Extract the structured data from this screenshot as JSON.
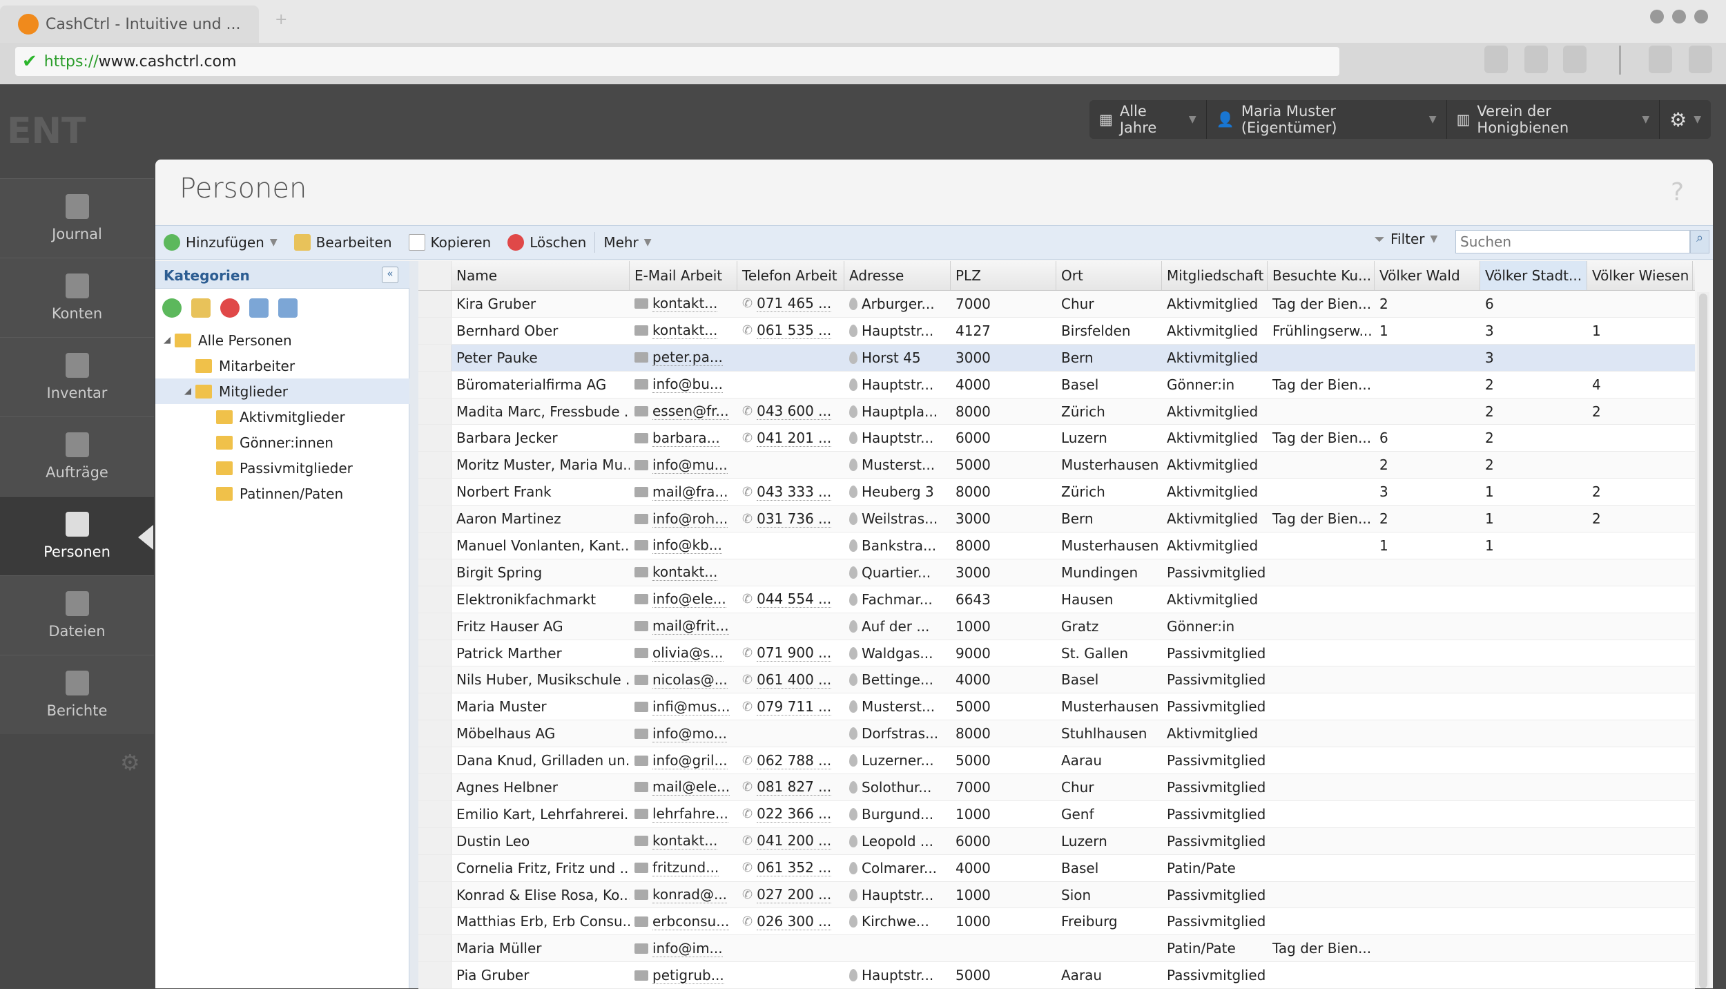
{
  "browser": {
    "tab_title": "CashCtrl - Intuitive und ...",
    "url_scheme": "https://",
    "url_host": "www.cashctrl.com",
    "new_tab": "+"
  },
  "topbar": {
    "year": "Alle Jahre",
    "user": "Maria Muster (Eigentümer)",
    "org": "Verein der Honigbienen"
  },
  "sidebar": {
    "items": [
      {
        "label": "Journal",
        "icon": "journal-icon"
      },
      {
        "label": "Konten",
        "icon": "bank-icon"
      },
      {
        "label": "Inventar",
        "icon": "inventory-icon"
      },
      {
        "label": "Aufträge",
        "icon": "orders-icon"
      },
      {
        "label": "Personen",
        "icon": "persons-icon",
        "active": true
      },
      {
        "label": "Dateien",
        "icon": "folder-icon"
      },
      {
        "label": "Berichte",
        "icon": "chart-icon"
      }
    ]
  },
  "page": {
    "title": "Personen",
    "help": "?"
  },
  "toolbar": {
    "add": "Hinzufügen",
    "edit": "Bearbeiten",
    "copy": "Kopieren",
    "delete": "Löschen",
    "more": "Mehr",
    "filter": "Filter",
    "search_placeholder": "Suchen"
  },
  "categories": {
    "title": "Kategorien",
    "tree": [
      {
        "label": "Alle Personen",
        "level": 0,
        "expanded": true
      },
      {
        "label": "Mitarbeiter",
        "level": 1
      },
      {
        "label": "Mitglieder",
        "level": 1,
        "expanded": true,
        "selected": true
      },
      {
        "label": "Aktivmitglieder",
        "level": 2
      },
      {
        "label": "Gönner:innen",
        "level": 2
      },
      {
        "label": "Passivmitglieder",
        "level": 2
      },
      {
        "label": "Patinnen/Paten",
        "level": 2
      }
    ]
  },
  "grid": {
    "columns": [
      "Name",
      "E-Mail Arbeit",
      "Telefon Arbeit",
      "Adresse",
      "PLZ",
      "Ort",
      "Mitgliedschaft",
      "Besuchte Ku...",
      "Völker Wald",
      "Völker Stadt...",
      "Völker Wiesen"
    ],
    "sorted_column": "Völker Stadt...",
    "selected_row": 2,
    "rows": [
      [
        "Kira Gruber",
        "kontakt...",
        "071 465 ...",
        "Arburger...",
        "7000",
        "Chur",
        "Aktivmitglied",
        "Tag der Bien...",
        "2",
        "6",
        ""
      ],
      [
        "Bernhard Ober",
        "kontakt...",
        "061 535 ...",
        "Hauptstr...",
        "4127",
        "Birsfelden",
        "Aktivmitglied",
        "Frühlingserw...",
        "1",
        "3",
        "1"
      ],
      [
        "Peter Pauke",
        "peter.pa...",
        "",
        "Horst 45",
        "3000",
        "Bern",
        "Aktivmitglied",
        "",
        "",
        "3",
        ""
      ],
      [
        "Büromaterialfirma AG",
        "info@bu...",
        "",
        "Hauptstr...",
        "4000",
        "Basel",
        "Gönner:in",
        "Tag der Bien...",
        "",
        "2",
        "4"
      ],
      [
        "Madita Marc, Fressbude ...",
        "essen@fr...",
        "043 600 ...",
        "Hauptpla...",
        "8000",
        "Zürich",
        "Aktivmitglied",
        "",
        "",
        "2",
        "2"
      ],
      [
        "Barbara Jecker",
        "barbara...",
        "041 201 ...",
        "Hauptstr...",
        "6000",
        "Luzern",
        "Aktivmitglied",
        "Tag der Bien...",
        "6",
        "2",
        ""
      ],
      [
        "Moritz Muster, Maria Mu...",
        "info@mu...",
        "",
        "Musterst...",
        "5000",
        "Musterhausen",
        "Aktivmitglied",
        "",
        "2",
        "2",
        ""
      ],
      [
        "Norbert Frank",
        "mail@fra...",
        "043 333 ...",
        "Heuberg 3",
        "8000",
        "Zürich",
        "Aktivmitglied",
        "",
        "3",
        "1",
        "2"
      ],
      [
        "Aaron Martinez",
        "info@roh...",
        "031 736 ...",
        "Weilstras...",
        "3000",
        "Bern",
        "Aktivmitglied",
        "Tag der Bien...",
        "2",
        "1",
        "2"
      ],
      [
        "Manuel Vonlanten, Kant...",
        "info@kb...",
        "",
        "Bankstra...",
        "8000",
        "Musterhausen",
        "Aktivmitglied",
        "",
        "1",
        "1",
        ""
      ],
      [
        "Birgit Spring",
        "kontakt...",
        "",
        "Quartier...",
        "3000",
        "Mundingen",
        "Passivmitglied",
        "",
        "",
        "",
        ""
      ],
      [
        "Elektronikfachmarkt",
        "info@ele...",
        "044 554 ...",
        "Fachmar...",
        "6643",
        "Hausen",
        "Aktivmitglied",
        "",
        "",
        "",
        ""
      ],
      [
        "Fritz Hauser AG",
        "mail@frit...",
        "",
        "Auf der ...",
        "1000",
        "Gratz",
        "Gönner:in",
        "",
        "",
        "",
        ""
      ],
      [
        "Patrick Marther",
        "olivia@s...",
        "071 900 ...",
        "Waldgas...",
        "9000",
        "St. Gallen",
        "Passivmitglied",
        "",
        "",
        "",
        ""
      ],
      [
        "Nils Huber, Musikschule ...",
        "nicolas@...",
        "061 400 ...",
        "Bettinge...",
        "4000",
        "Basel",
        "Passivmitglied",
        "",
        "",
        "",
        ""
      ],
      [
        "Maria Muster",
        "infi@mus...",
        "079 711 ...",
        "Musterst...",
        "5000",
        "Musterhausen",
        "Passivmitglied",
        "",
        "",
        "",
        ""
      ],
      [
        "Möbelhaus AG",
        "info@mo...",
        "",
        "Dorfstras...",
        "8000",
        "Stuhlhausen",
        "Aktivmitglied",
        "",
        "",
        "",
        ""
      ],
      [
        "Dana Knud, Grilladen un...",
        "info@gril...",
        "062 788 ...",
        "Luzerner...",
        "5000",
        "Aarau",
        "Passivmitglied",
        "",
        "",
        "",
        ""
      ],
      [
        "Agnes Helbner",
        "mail@ele...",
        "081 827 ...",
        "Solothur...",
        "7000",
        "Chur",
        "Passivmitglied",
        "",
        "",
        "",
        ""
      ],
      [
        "Emilio Kart, Lehrfahrerei...",
        "lehrfahre...",
        "022 366 ...",
        "Burgund...",
        "1000",
        "Genf",
        "Passivmitglied",
        "",
        "",
        "",
        ""
      ],
      [
        "Dustin Leo",
        "kontakt...",
        "041 200 ...",
        "Leopold ...",
        "6000",
        "Luzern",
        "Passivmitglied",
        "",
        "",
        "",
        ""
      ],
      [
        "Cornelia Fritz, Fritz und ...",
        "fritzund...",
        "061 352 ...",
        "Colmarer...",
        "4000",
        "Basel",
        "Patin/Pate",
        "",
        "",
        "",
        ""
      ],
      [
        "Konrad & Elise Rosa, Ko...",
        "konrad@...",
        "027 200 ...",
        "Hauptstr...",
        "1000",
        "Sion",
        "Passivmitglied",
        "",
        "",
        "",
        ""
      ],
      [
        "Matthias Erb, Erb Consu...",
        "erbconsu...",
        "026 300 ...",
        "Kirchwe...",
        "1000",
        "Freiburg",
        "Passivmitglied",
        "",
        "",
        "",
        ""
      ],
      [
        "Maria Müller",
        "info@im...",
        "",
        "",
        "",
        "",
        "Patin/Pate",
        "Tag der Bien...",
        "",
        "",
        ""
      ],
      [
        "Pia Gruber",
        "petigrub...",
        "",
        "Hauptstr...",
        "5000",
        "Aarau",
        "Passivmitglied",
        "",
        "",
        "",
        ""
      ]
    ]
  },
  "colors": {
    "accent": "#2c5d92",
    "selected_row": "#dde6f4",
    "sidebar": "#484848"
  }
}
